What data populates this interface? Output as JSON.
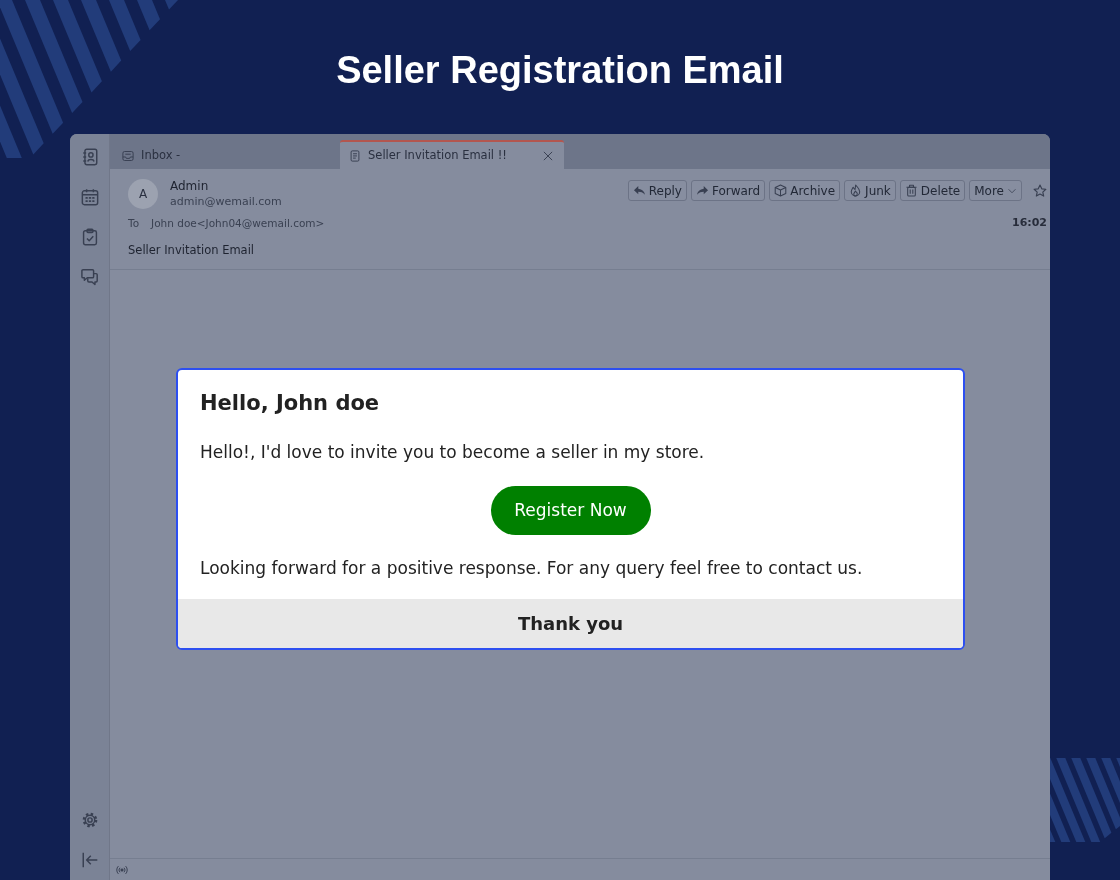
{
  "page_title": "Seller Registration Email",
  "tabs": [
    {
      "kind": "inbox",
      "label": "Inbox -",
      "selected": false,
      "closable": false
    },
    {
      "kind": "message",
      "label": "Seller Invitation Email !!",
      "selected": true,
      "closable": true
    }
  ],
  "message": {
    "sender": {
      "initial": "A",
      "name": "Admin",
      "email": "admin@wemail.com"
    },
    "to_label": "To",
    "recipient": "John doe<John04@wemail.com>",
    "time": "16:02",
    "subject": "Seller Invitation Email",
    "actions": [
      {
        "kind": "reply",
        "label": "Reply"
      },
      {
        "kind": "forward",
        "label": "Forward"
      },
      {
        "kind": "archive",
        "label": "Archive"
      },
      {
        "kind": "junk",
        "label": "Junk"
      },
      {
        "kind": "delete",
        "label": "Delete"
      },
      {
        "kind": "more",
        "label": "More"
      }
    ]
  },
  "email_card": {
    "heading": "Hello, John doe",
    "intro": "Hello!, I'd love to invite you to become a seller in my store.",
    "button": "Register Now",
    "closing": "Looking forward for a positive response. For any query feel free to contact us.",
    "footer": "Thank you"
  }
}
